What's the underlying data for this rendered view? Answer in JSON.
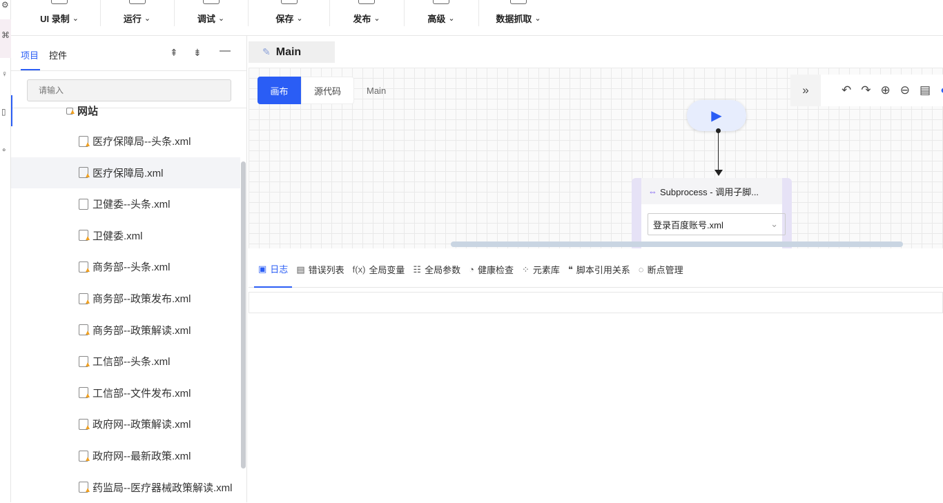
{
  "toolbar": {
    "items": [
      {
        "label": "UI 录制",
        "icon": "record-icon"
      },
      {
        "label": "运行",
        "icon": "run-icon"
      },
      {
        "label": "调试",
        "icon": "debug-icon"
      },
      {
        "label": "保存",
        "icon": "save-icon"
      },
      {
        "label": "发布",
        "icon": "publish-icon"
      },
      {
        "label": "高级",
        "icon": "advanced-icon"
      },
      {
        "label": "数据抓取",
        "icon": "data-scrape-icon"
      }
    ]
  },
  "panel": {
    "tabs": [
      "项目",
      "控件"
    ],
    "active_tab": "项目",
    "search_placeholder": "请输入",
    "folder": "网站",
    "files": [
      {
        "name": "医疗保障局--头条.xml",
        "warn": true
      },
      {
        "name": "医疗保障局.xml",
        "warn": true
      },
      {
        "name": "卫健委--头条.xml",
        "warn": false
      },
      {
        "name": "卫健委.xml",
        "warn": true
      },
      {
        "name": "商务部--头条.xml",
        "warn": true
      },
      {
        "name": "商务部--政策发布.xml",
        "warn": true
      },
      {
        "name": "商务部--政策解读.xml",
        "warn": true
      },
      {
        "name": "工信部--头条.xml",
        "warn": true
      },
      {
        "name": "工信部--文件发布.xml",
        "warn": true
      },
      {
        "name": "政府网--政策解读.xml",
        "warn": true
      },
      {
        "name": "政府网--最新政策.xml",
        "warn": true
      },
      {
        "name": "药监局--医疗器械政策解读.xml",
        "warn": true
      }
    ]
  },
  "editor": {
    "tab": "Main",
    "view_tabs": [
      "画布",
      "源代码"
    ],
    "active_view": "画布",
    "breadcrumb": "Main",
    "node": {
      "title": "Subprocess - 调用子脚...",
      "value": "登录百度账号.xml"
    }
  },
  "bottom": {
    "tabs": [
      {
        "label": "日志",
        "icon": "calendar-icon"
      },
      {
        "label": "错误列表",
        "icon": "error-list-icon"
      },
      {
        "label": "全局变量",
        "icon": "fx-icon"
      },
      {
        "label": "全局参数",
        "icon": "params-icon"
      },
      {
        "label": "健康检查",
        "icon": "health-icon"
      },
      {
        "label": "元素库",
        "icon": "grid-icon"
      },
      {
        "label": "脚本引用关系",
        "icon": "quote-icon"
      },
      {
        "label": "断点管理",
        "icon": "breakpoint-icon"
      }
    ],
    "active": "日志"
  },
  "colors": {
    "accent": "#2a5df5"
  }
}
